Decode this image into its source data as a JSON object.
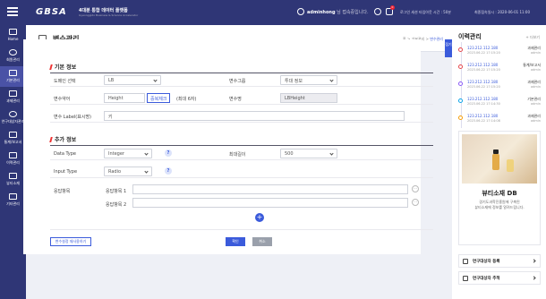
{
  "header": {
    "logo": "GBSA",
    "logo_sub": "4대분 통합 데이터 플랫폼",
    "logo_sub2": "Gyeonggido Business & Science Accelerator",
    "user_name": "adminhong",
    "user_suffix": "님 접속중입니다.",
    "notification_count": "0",
    "session_info": "로그인 세션 타임아웃 시간 : 50분",
    "last_access": "최종접속일시 : 2020-06-01 11:00"
  },
  "sidebar": {
    "items": [
      {
        "label": "Home",
        "icon": "home-icon"
      },
      {
        "label": "회원관리",
        "icon": "user-icon"
      },
      {
        "label": "기본관리",
        "icon": "monitor-icon"
      },
      {
        "label": "과제관리",
        "icon": "task-icon"
      },
      {
        "label": "연구대상자관리",
        "icon": "people-icon"
      },
      {
        "label": "통계/보고서",
        "icon": "chart-icon"
      },
      {
        "label": "이력관리",
        "icon": "history-icon"
      },
      {
        "label": "뷰티소재",
        "icon": "beauty-icon"
      },
      {
        "label": "기타관리",
        "icon": "etc-icon"
      }
    ],
    "active_index": 2
  },
  "page": {
    "title": "변수관리",
    "breadcrumb": [
      "홈",
      "기본관리",
      "변수관리"
    ]
  },
  "basic": {
    "section_title": "기본 정보",
    "domain_label": "도메인 선택",
    "domain_value": "LB",
    "group_label": "변수그룹",
    "group_value": "투대 정보",
    "code_label": "변수약어",
    "code_value": "Height",
    "dup_check": "중복체크",
    "max_hint": "(최대 6자)",
    "name_label": "변수명",
    "name_value": "LBHeight",
    "text_label": "변수 Label(표시명)",
    "text_value": "키"
  },
  "extra": {
    "section_title": "추가 정보",
    "dtype_label": "Data Type",
    "dtype_value": "Integer",
    "maxlen_label": "최대길이",
    "maxlen_value": "500",
    "itype_label": "Input Type",
    "itype_value": "Radio",
    "answers_label": "응답항목",
    "answer_items": [
      "응답항목 1",
      "응답항목 2"
    ],
    "help": "?",
    "more": "···",
    "add": "+"
  },
  "buttons": {
    "reset": "변수설정 재사용하기",
    "confirm": "확인",
    "cancel": "취소"
  },
  "history": {
    "title": "이력관리",
    "more": "+ 더보기",
    "fold_label": "접기",
    "items": [
      {
        "ip": "123.212.112.180",
        "date": "2023.06.22 17:15:20",
        "menu": "과제관리",
        "user": "admin",
        "color": "#e5484d"
      },
      {
        "ip": "123.212.112.180",
        "date": "2023.06.22 17:15:20",
        "menu": "통계/보고서",
        "user": "admin",
        "color": "#e5484d"
      },
      {
        "ip": "123.212.112.180",
        "date": "2023.06.22 17:15:20",
        "menu": "과제관리",
        "user": "admin",
        "color": "#8b5cf6"
      },
      {
        "ip": "123.212.112.180",
        "date": "2023.06.22 17:14:30",
        "menu": "기본관리",
        "user": "admin",
        "color": "#0ea5e9"
      },
      {
        "ip": "123.212.112.180",
        "date": "2023.06.22 17:14:08",
        "menu": "과제관리",
        "user": "admin",
        "color": "#f59e0b"
      }
    ]
  },
  "card": {
    "title": "뷰티소재 DB",
    "desc1": "경기도과학진흥원에 구축된",
    "desc2": "뷰티소재에 정보를 알려드립니다."
  },
  "links": [
    {
      "label": "연구대상자 등록",
      "icon": "edit-icon"
    },
    {
      "label": "연구대상자 추적",
      "icon": "layers-icon"
    }
  ]
}
